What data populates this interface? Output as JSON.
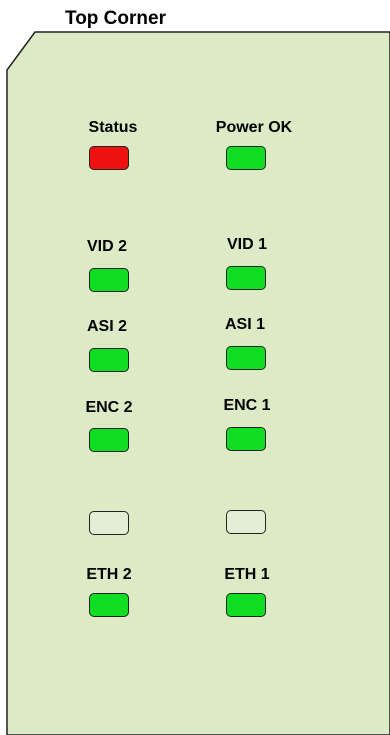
{
  "title": "Top Corner",
  "panel": {
    "fill": "#dcebc5",
    "stroke": "#222222"
  },
  "colors": {
    "red": "#ee1111",
    "green": "#11dd22",
    "off": "#e4eed6"
  },
  "rows": [
    {
      "left": {
        "label": "Status",
        "led": "red"
      },
      "right": {
        "label": "Power OK",
        "led": "green"
      }
    },
    {
      "left": {
        "label": "VID 2",
        "led": "green"
      },
      "right": {
        "label": "VID 1",
        "led": "green"
      }
    },
    {
      "left": {
        "label": "ASI 2",
        "led": "green"
      },
      "right": {
        "label": "ASI 1",
        "led": "green"
      }
    },
    {
      "left": {
        "label": "ENC 2",
        "led": "green"
      },
      "right": {
        "label": "ENC 1",
        "led": "green"
      }
    },
    {
      "left": {
        "label": "",
        "led": "off"
      },
      "right": {
        "label": "",
        "led": "off"
      }
    },
    {
      "left": {
        "label": "ETH 2",
        "led": "green"
      },
      "right": {
        "label": "ETH 1",
        "led": "green"
      }
    }
  ]
}
